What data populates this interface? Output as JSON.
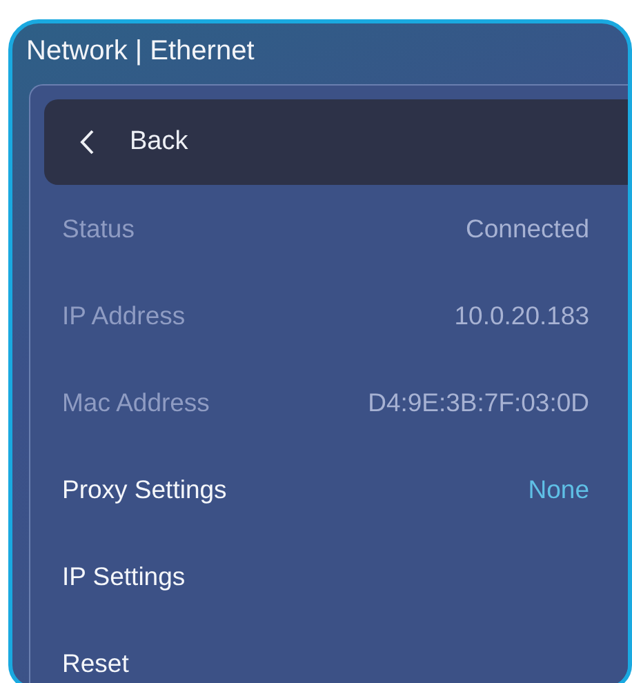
{
  "window": {
    "title": "Network | Ethernet"
  },
  "back": {
    "label": "Back"
  },
  "rows": [
    {
      "kind": "info",
      "label": "Status",
      "value": "Connected"
    },
    {
      "kind": "info",
      "label": "IP Address",
      "value": "10.0.20.183"
    },
    {
      "kind": "info",
      "label": "Mac Address",
      "value": "D4:9E:3B:7F:03:0D"
    },
    {
      "kind": "option",
      "label": "Proxy Settings",
      "value": "None"
    },
    {
      "kind": "option",
      "label": "IP Settings"
    },
    {
      "kind": "option",
      "label": "Reset"
    }
  ]
}
